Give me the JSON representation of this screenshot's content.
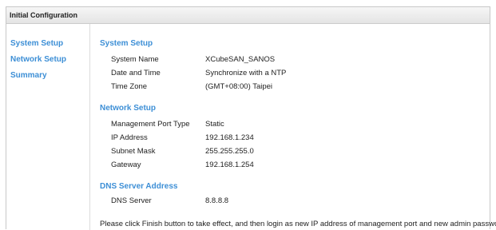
{
  "window": {
    "title": "Initial Configuration"
  },
  "sidebar": {
    "items": [
      {
        "label": "System Setup"
      },
      {
        "label": "Network Setup"
      },
      {
        "label": "Summary"
      }
    ]
  },
  "sections": {
    "system": {
      "title": "System Setup",
      "rows": [
        {
          "label": "System Name",
          "value": "XCubeSAN_SANOS"
        },
        {
          "label": "Date and Time",
          "value": "Synchronize with a NTP"
        },
        {
          "label": "Time Zone",
          "value": "(GMT+08:00) Taipei"
        }
      ]
    },
    "network": {
      "title": "Network Setup",
      "rows": [
        {
          "label": "Management Port Type",
          "value": "Static"
        },
        {
          "label": "IP Address",
          "value": "192.168.1.234"
        },
        {
          "label": "Subnet Mask",
          "value": "255.255.255.0"
        },
        {
          "label": "Gateway",
          "value": "192.168.1.254"
        }
      ]
    },
    "dns": {
      "title": "DNS Server Address",
      "rows": [
        {
          "label": "DNS Server",
          "value": "8.8.8.8"
        }
      ]
    }
  },
  "footer": {
    "note": "Please click Finish button to take effect, and then login as new IP address of management port and new admin password."
  },
  "colors": {
    "accent": "#3d8fd6",
    "text": "#222222",
    "border": "#c8c8c8"
  }
}
